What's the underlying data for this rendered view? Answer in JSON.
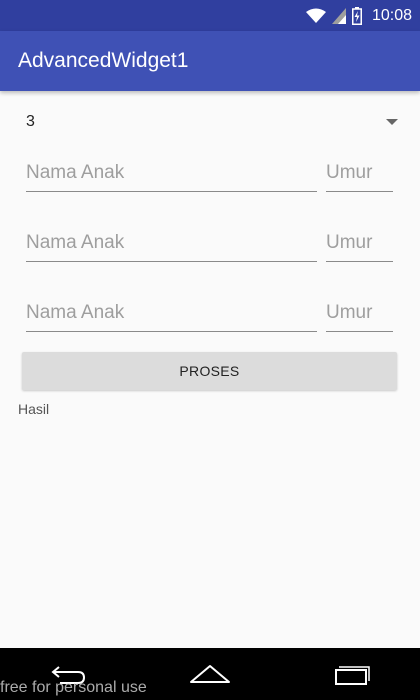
{
  "status_bar": {
    "time": "10:08",
    "icons": [
      "wifi-icon",
      "signal-icon",
      "battery-icon"
    ]
  },
  "app_bar": {
    "title": "AdvancedWidget1"
  },
  "spinner": {
    "selected_value": "3",
    "icon": "dropdown-arrow-icon"
  },
  "inputs": [
    {
      "name_placeholder": "Nama Anak",
      "age_placeholder": "Umur"
    },
    {
      "name_placeholder": "Nama Anak",
      "age_placeholder": "Umur"
    },
    {
      "name_placeholder": "Nama Anak",
      "age_placeholder": "Umur"
    }
  ],
  "process_button": {
    "label": "PROSES"
  },
  "result": {
    "label": "Hasil"
  },
  "nav_bar": {
    "icons": [
      "back-icon",
      "home-icon",
      "recents-icon"
    ]
  },
  "watermark": {
    "text": "free for personal use"
  }
}
